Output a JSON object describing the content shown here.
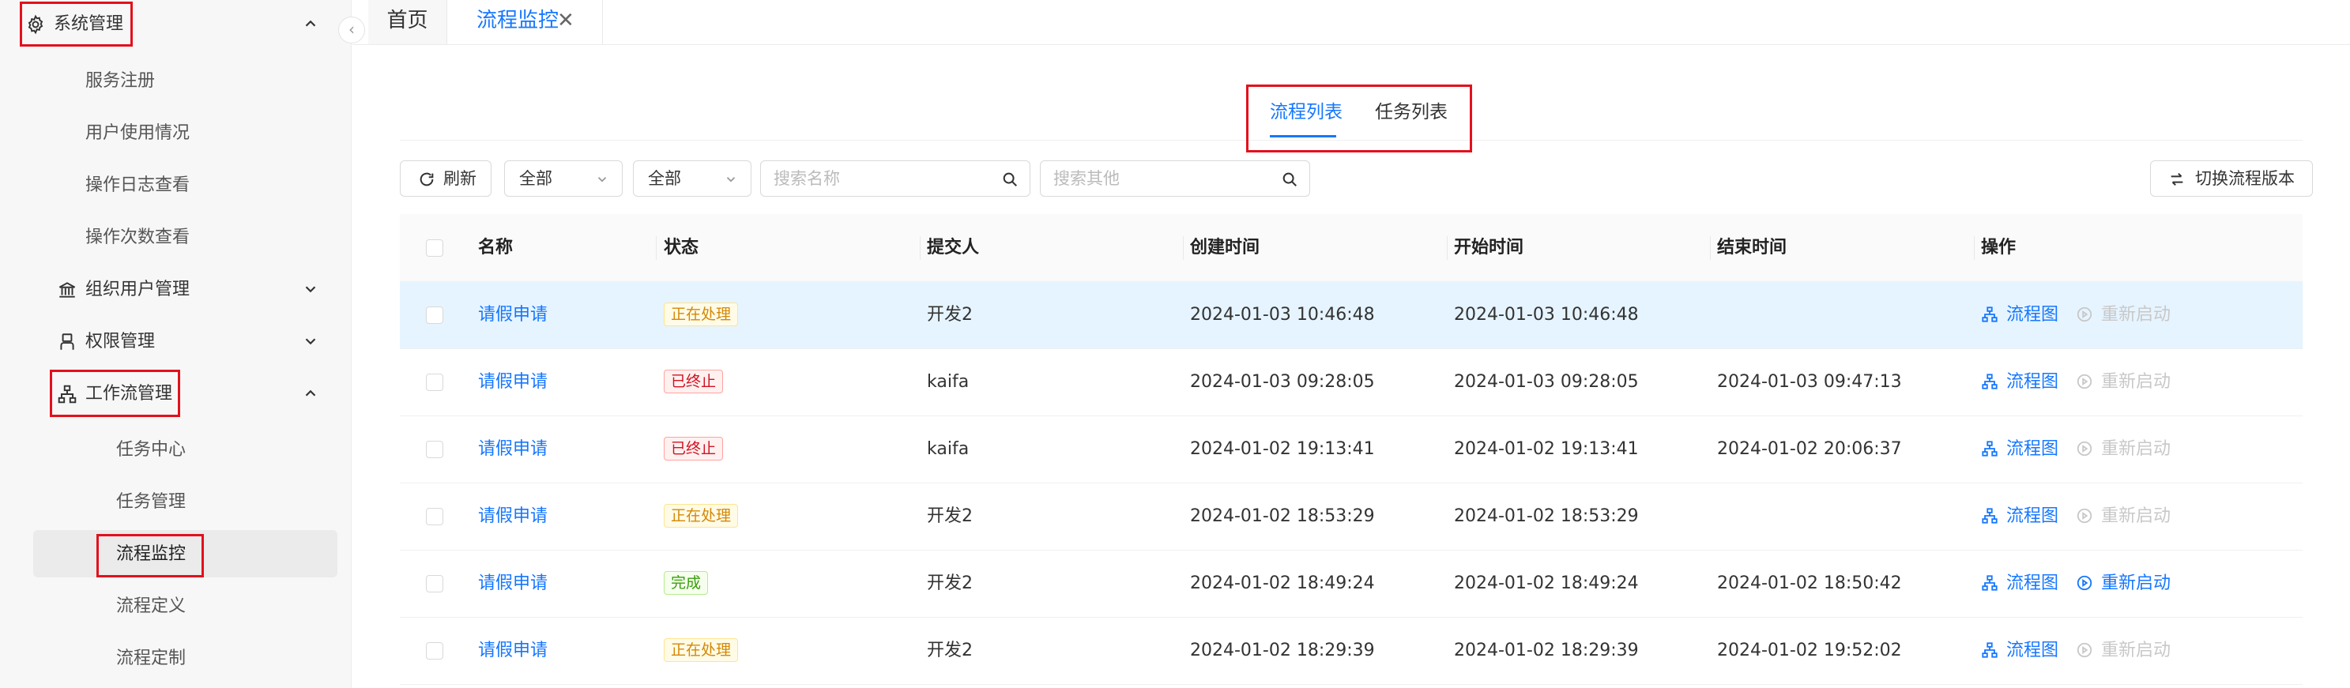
{
  "sidebar": {
    "collapse_glyph": "‹",
    "system_mgmt": {
      "label": "系统管理",
      "icon": "gear-icon"
    },
    "system_children": [
      "服务注册",
      "用户使用情况",
      "操作日志查看",
      "操作次数查看"
    ],
    "org_user": {
      "label": "组织用户管理",
      "icon": "bank-icon"
    },
    "permission": {
      "label": "权限管理",
      "icon": "user-icon"
    },
    "workflow": {
      "label": "工作流管理",
      "icon": "org-chart-icon"
    },
    "workflow_children": [
      "任务中心",
      "任务管理",
      "流程监控",
      "流程定义",
      "流程定制"
    ],
    "active_child": "流程监控"
  },
  "tabs": {
    "home": "首页",
    "active": "流程监控",
    "close_glyph": "✕"
  },
  "subtabs": {
    "process_list": "流程列表",
    "task_list": "任务列表",
    "active": "流程列表"
  },
  "toolbar": {
    "refresh_label": "刷新",
    "filter1_value": "全部",
    "filter2_value": "全部",
    "search_name_placeholder": "搜索名称",
    "search_other_placeholder": "搜索其他",
    "switch_version_label": "切换流程版本"
  },
  "table": {
    "columns": [
      "名称",
      "状态",
      "提交人",
      "创建时间",
      "开始时间",
      "结束时间",
      "操作"
    ],
    "rows": [
      {
        "name": "请假申请",
        "status": "正在处理",
        "status_type": "processing",
        "submitter": "开发2",
        "created": "2024-01-03 10:46:48",
        "started": "2024-01-03 10:46:48",
        "ended": "",
        "restart_enabled": false
      },
      {
        "name": "请假申请",
        "status": "已终止",
        "status_type": "terminated",
        "submitter": "kaifa",
        "created": "2024-01-03 09:28:05",
        "started": "2024-01-03 09:28:05",
        "ended": "2024-01-03 09:47:13",
        "restart_enabled": false
      },
      {
        "name": "请假申请",
        "status": "已终止",
        "status_type": "terminated",
        "submitter": "kaifa",
        "created": "2024-01-02 19:13:41",
        "started": "2024-01-02 19:13:41",
        "ended": "2024-01-02 20:06:37",
        "restart_enabled": false
      },
      {
        "name": "请假申请",
        "status": "正在处理",
        "status_type": "processing",
        "submitter": "开发2",
        "created": "2024-01-02 18:53:29",
        "started": "2024-01-02 18:53:29",
        "ended": "",
        "restart_enabled": false
      },
      {
        "name": "请假申请",
        "status": "完成",
        "status_type": "done",
        "submitter": "开发2",
        "created": "2024-01-02 18:49:24",
        "started": "2024-01-02 18:49:24",
        "ended": "2024-01-02 18:50:42",
        "restart_enabled": true
      },
      {
        "name": "请假申请",
        "status": "正在处理",
        "status_type": "processing",
        "submitter": "开发2",
        "created": "2024-01-02 18:29:39",
        "started": "2024-01-02 18:29:39",
        "ended": "2024-01-02 19:52:02",
        "restart_enabled": false
      }
    ],
    "action_diagram": "流程图",
    "action_restart": "重新启动"
  },
  "colors": {
    "primary": "#1677ff",
    "highlight": "#e3101c",
    "row_hover": "#e6f4ff"
  }
}
